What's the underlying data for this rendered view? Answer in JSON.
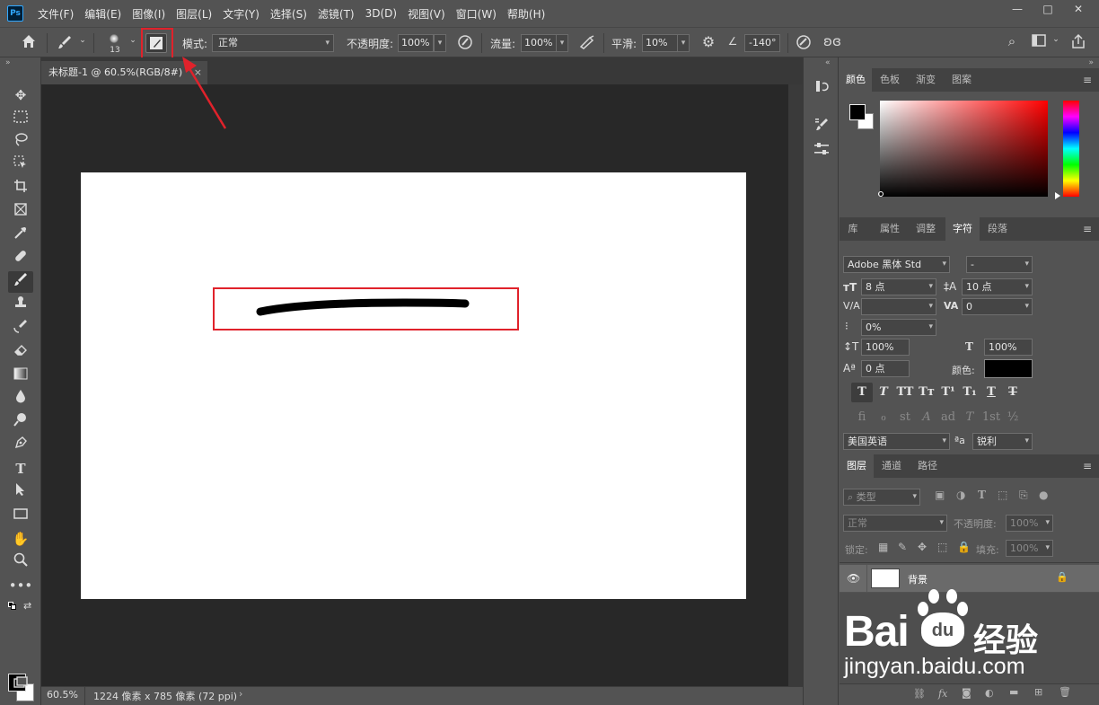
{
  "app": {
    "logo": "Ps"
  },
  "menu": [
    "文件(F)",
    "编辑(E)",
    "图像(I)",
    "图层(L)",
    "文字(Y)",
    "选择(S)",
    "滤镜(T)",
    "3D(D)",
    "视图(V)",
    "窗口(W)",
    "帮助(H)"
  ],
  "window_buttons": {
    "minimize": "—",
    "maximize": "□",
    "close": "✕"
  },
  "options": {
    "brush_size": "13",
    "mode_label": "模式:",
    "mode_value": "正常",
    "opacity_label": "不透明度:",
    "opacity_value": "100%",
    "flow_label": "流量:",
    "flow_value": "100%",
    "smooth_label": "平滑:",
    "smooth_value": "10%",
    "angle_value": "-140°"
  },
  "document": {
    "tab_title": "未标题-1 @ 60.5%(RGB/8#)",
    "tab_close": "×",
    "zoom": "60.5%",
    "doc_info": "1224 像素 x 785 像素 (72 ppi)",
    "status_arrow": "›"
  },
  "color_panel": {
    "tabs": [
      "颜色",
      "色板",
      "渐变",
      "图案"
    ],
    "foreground": "#000000",
    "background": "#ffffff",
    "hue": "#ff0000"
  },
  "character_panel": {
    "tabs": [
      "库",
      "属性",
      "调整",
      "字符",
      "段落"
    ],
    "font_family": "Adobe 黑体 Std",
    "font_style": "-",
    "font_size": "8 点",
    "leading": "10 点",
    "kerning": "",
    "tracking": "0",
    "tsume": "0%",
    "vertical_scale": "100%",
    "horizontal_scale": "100%",
    "baseline_shift": "0 点",
    "color_label": "颜色:",
    "text_color": "#000000",
    "style_buttons": [
      "T",
      "T",
      "TT",
      "Tт",
      "T¹",
      "T₁",
      "T",
      "T"
    ],
    "opentype_buttons": [
      "fi",
      "ℴ",
      "st",
      "A",
      "ad",
      "T",
      "1st",
      "½"
    ],
    "language": "美国英语",
    "aa_label": "ªa",
    "antialias": "锐利"
  },
  "layers_panel": {
    "tabs": [
      "图层",
      "通道",
      "路径"
    ],
    "filter_kind": "类型",
    "blend_mode": "正常",
    "opacity_label": "不透明度:",
    "opacity_value": "100%",
    "lock_label": "锁定:",
    "fill_label": "填充:",
    "fill_value": "100%",
    "layers": [
      {
        "name": "背景"
      }
    ],
    "footer_icons": [
      "link-icon",
      "fx-icon",
      "mask-icon",
      "adjustment-icon",
      "group-icon",
      "new-layer-icon",
      "trash-icon"
    ]
  },
  "watermark": {
    "line1": "Bai",
    "line2": "经验",
    "line3": "jingyan.baidu.com",
    "paw": "du"
  },
  "annotation": {
    "highlight_color": "#e0222b"
  }
}
